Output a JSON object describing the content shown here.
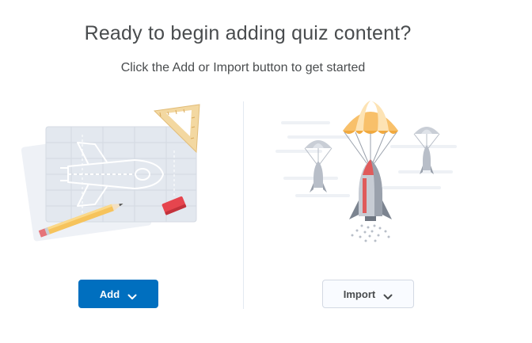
{
  "heading": "Ready to begin adding quiz content?",
  "subheading": "Click the Add or Import button to get started",
  "add_button": {
    "label": "Add"
  },
  "import_button": {
    "label": "Import"
  },
  "colors": {
    "primary": "#006fbf",
    "text": "#494c4e",
    "divider": "#e3e9f1",
    "parachute_orange": "#f8c06a",
    "rocket_red": "#e05b5b"
  },
  "icons": {
    "left_illustration": "blueprint-rocket-illustration",
    "right_illustration": "parachute-rocket-illustration",
    "dropdown": "chevron-down-icon"
  }
}
